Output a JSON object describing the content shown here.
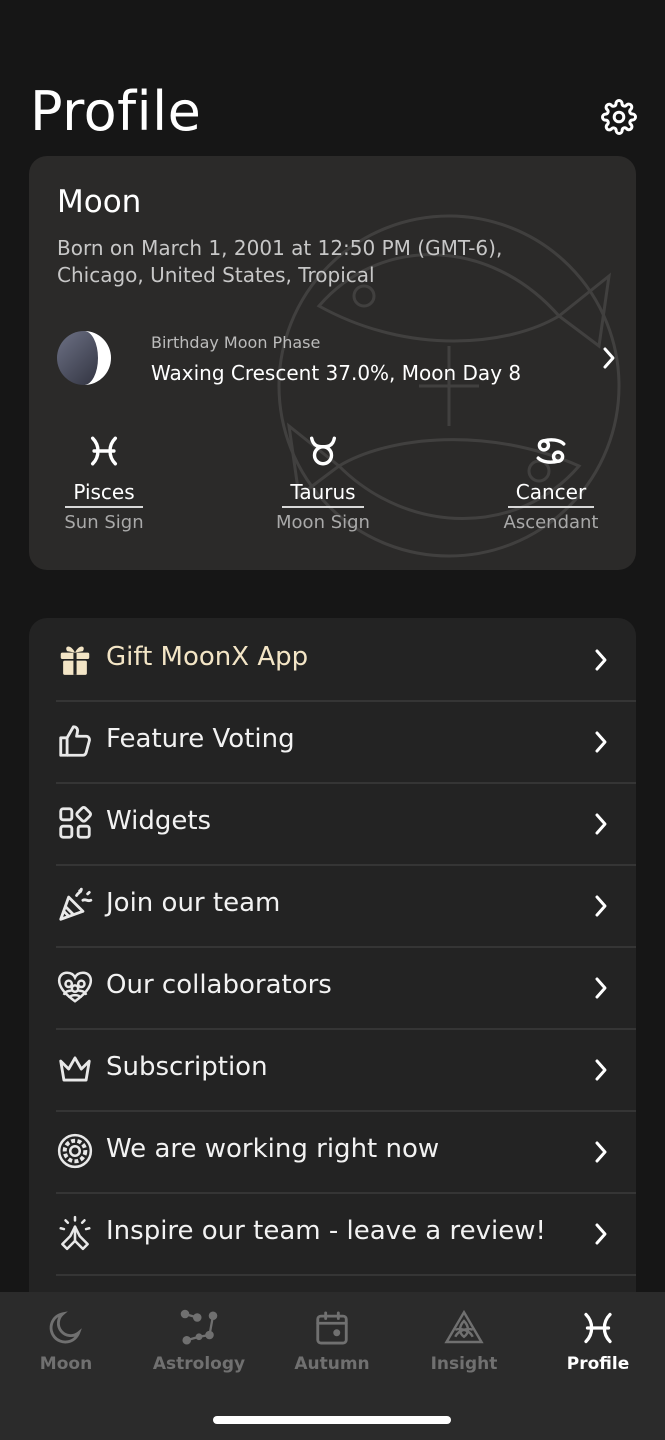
{
  "header": {
    "title": "Profile"
  },
  "profile": {
    "name": "Moon",
    "birth_line_1": "Born on March 1, 2001 at 12:50 PM (GMT-6),",
    "birth_line_2": "Chicago, United States, Tropical",
    "moon_phase_caption": "Birthday Moon Phase",
    "moon_phase_value": "Waxing Crescent 37.0%, Moon Day 8",
    "signs": [
      {
        "glyph": "pisces-icon",
        "name": "Pisces",
        "label": "Sun Sign"
      },
      {
        "glyph": "taurus-icon",
        "name": "Taurus",
        "label": "Moon Sign"
      },
      {
        "glyph": "cancer-icon",
        "name": "Cancer",
        "label": "Ascendant"
      }
    ]
  },
  "menu": {
    "items": [
      {
        "icon": "gift-icon",
        "label": "Gift MoonX App"
      },
      {
        "icon": "thumbs-up-icon",
        "label": "Feature Voting"
      },
      {
        "icon": "widgets-icon",
        "label": "Widgets"
      },
      {
        "icon": "party-popper-icon",
        "label": "Join our team"
      },
      {
        "icon": "collaborators-icon",
        "label": "Our collaborators"
      },
      {
        "icon": "crown-icon",
        "label": "Subscription"
      },
      {
        "icon": "gear-cog-icon",
        "label": "We are working right now"
      },
      {
        "icon": "praying-hands-icon",
        "label": "Inspire our team - leave a review!"
      }
    ]
  },
  "tabbar": {
    "tabs": [
      {
        "icon": "crescent-moon-icon",
        "label": "Moon"
      },
      {
        "icon": "constellation-icon",
        "label": "Astrology"
      },
      {
        "icon": "calendar-icon",
        "label": "Autumn"
      },
      {
        "icon": "triquetra-icon",
        "label": "Insight"
      },
      {
        "icon": "pisces-icon",
        "label": "Profile"
      }
    ],
    "active": "Profile"
  },
  "colors": {
    "accent": "#f3e5c6",
    "background": "#161616",
    "card": "#2b2a29"
  }
}
